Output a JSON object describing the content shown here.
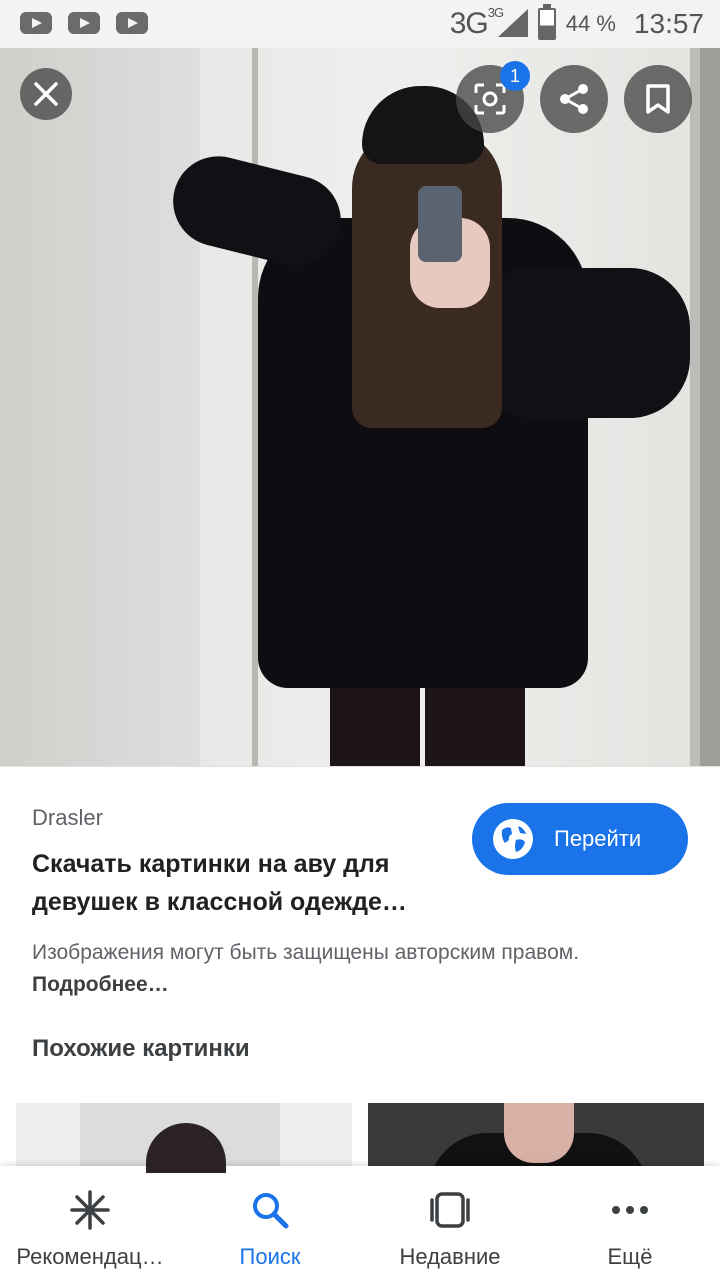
{
  "status_bar": {
    "network": "3G",
    "network_small": "3G",
    "battery_percent": "44 %",
    "time": "13:57",
    "notification_icons": [
      "youtube-icon",
      "youtube-icon",
      "youtube-icon"
    ]
  },
  "viewer": {
    "lens_badge_count": "1",
    "buttons": [
      "close-icon",
      "lens-icon",
      "share-icon",
      "bookmark-icon"
    ]
  },
  "result": {
    "source": "Drasler",
    "title": "Скачать картинки на аву для девушек в классной одежде…",
    "visit_label": "Перейти",
    "notice_text": "Изображения могут быть защищены авторским правом.",
    "notice_link": "Подробнее…",
    "similar_heading": "Похожие картинки"
  },
  "bottom_nav": {
    "items": [
      {
        "label": "Рекомендац…",
        "icon": "asterisk-icon"
      },
      {
        "label": "Поиск",
        "icon": "search-icon"
      },
      {
        "label": "Недавние",
        "icon": "recent-tabs-icon"
      },
      {
        "label": "Ещё",
        "icon": "more-icon"
      }
    ],
    "active": "Поиск"
  },
  "colors": {
    "accent": "#1a73e8",
    "status_bar_bg": "#f3f3f3",
    "overlay_button": "#464646"
  }
}
